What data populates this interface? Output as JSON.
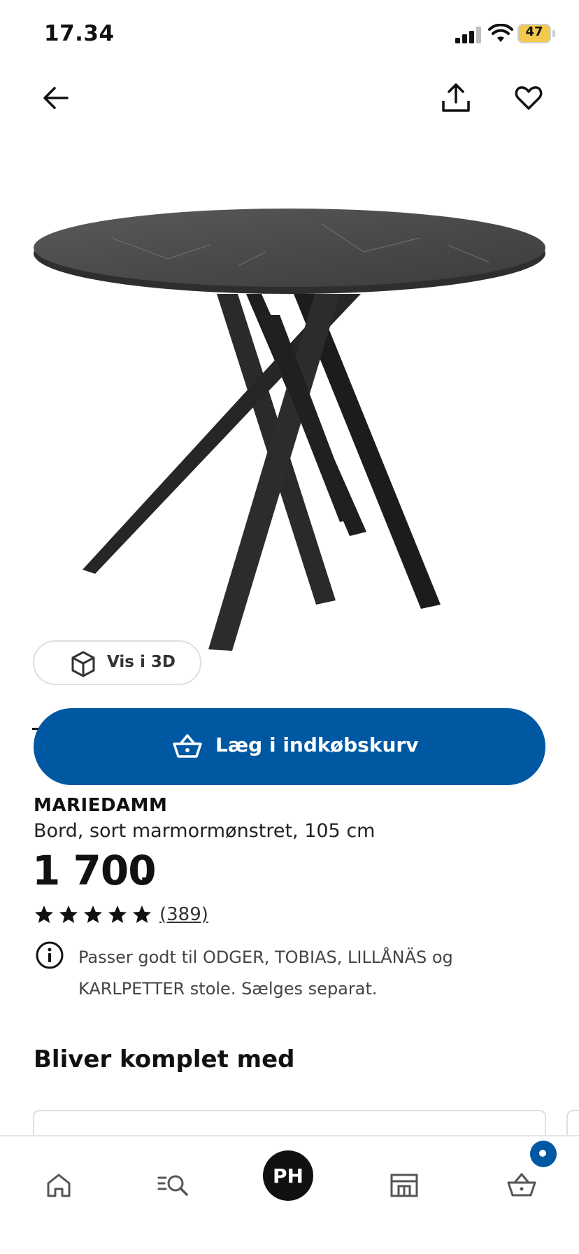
{
  "status_bar": {
    "time": "17.34",
    "battery": "47"
  },
  "header": {
    "back_icon": "arrow-left-icon",
    "share_icon": "share-upload-icon",
    "favorite_icon": "heart-icon"
  },
  "product": {
    "view_3d_label": "Vis i 3D",
    "add_to_cart_label": "Læg i indkøbskurv",
    "name": "MARIEDAMM",
    "description": "Bord, sort marmormønstret, 105 cm",
    "price": "1 700",
    "price_suffix": ".-",
    "rating": 5,
    "review_count": "(389)",
    "info_text": "Passer godt til ODGER, TOBIAS, LILLÅNÄS og KARLPETTER stole. Sælges separat."
  },
  "section": {
    "title": "Bliver komplet med"
  },
  "bottom_nav": {
    "profile_initials": "PH",
    "items": [
      "home-icon",
      "search-icon",
      "profile-avatar",
      "store-icon",
      "cart-icon"
    ]
  },
  "colors": {
    "brand_blue": "#0058a3",
    "battery_yellow": "#f2c94c"
  }
}
